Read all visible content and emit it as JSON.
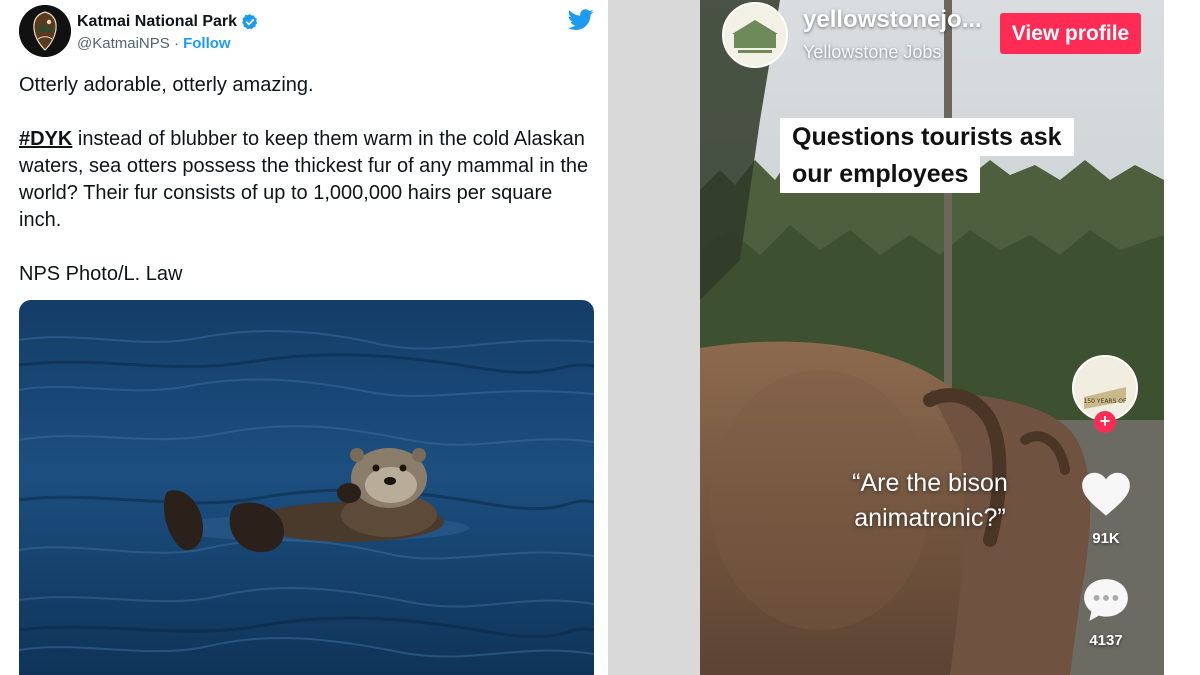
{
  "tweet": {
    "account_name": "Katmai National Park",
    "handle": "@KatmaiNPS",
    "separator": "·",
    "follow_label": "Follow",
    "verified_icon": "verified-badge-icon",
    "platform_icon": "twitter-bird-icon",
    "line1": "Otterly adorable, otterly amazing.",
    "hashtag": "#DYK",
    "paragraph_rest": " instead of blubber to keep them warm in the cold Alaskan waters, sea otters possess the thickest fur of any mammal in the world? Their fur consists of up to 1,000,000 hairs per square inch.",
    "credit": "NPS Photo/L. Law",
    "colors": {
      "link": "#1d9bf0",
      "verified": "#1d9bf0"
    }
  },
  "tiktok": {
    "username": "yellowstonejo...",
    "display_name": "Yellowstone Jobs",
    "view_profile_label": "View profile",
    "caption_line1": "Questions tourists ask",
    "caption_line2": "our employees",
    "quote_line1": "“Are the bison",
    "quote_line2": "animatronic?”",
    "creator_badge_text": "150 YEARS OF",
    "likes": "91K",
    "comments": "4137",
    "colors": {
      "accent": "#fe2c55"
    }
  }
}
